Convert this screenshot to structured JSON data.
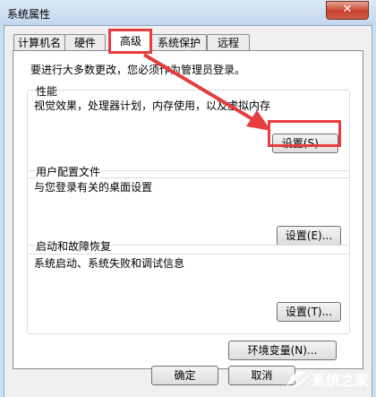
{
  "window": {
    "title": "系统属性",
    "close_symbol": "✕"
  },
  "tabs": [
    {
      "label": "计算机名"
    },
    {
      "label": "硬件"
    },
    {
      "label": "高级",
      "active": true
    },
    {
      "label": "系统保护"
    },
    {
      "label": "远程"
    }
  ],
  "notice": "要进行大多数更改，您必须作为管理员登录。",
  "performance": {
    "title": "性能",
    "description": "视觉效果，处理器计划，内存使用，以及虚拟内存",
    "button": "设置(S)..."
  },
  "user_profiles": {
    "title": "用户配置文件",
    "description": "与您登录有关的桌面设置",
    "button": "设置(E)..."
  },
  "startup_recovery": {
    "title": "启动和故障恢复",
    "description": "系统启动、系统失败和调试信息",
    "button": "设置(T)..."
  },
  "env_button": "环境变量(N)...",
  "footer": {
    "ok": "确定",
    "cancel": "取消"
  },
  "annotation_color": "#e63e3e",
  "watermark": {
    "text": "系统之家"
  }
}
